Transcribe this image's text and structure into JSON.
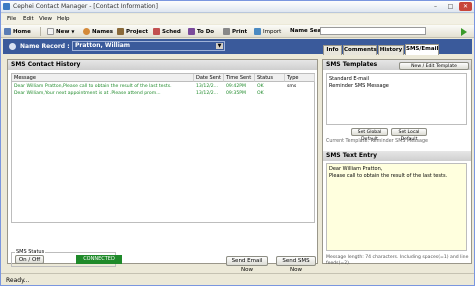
{
  "window": {
    "title": "Cephei Contact Manager - [Contact Information]"
  },
  "menu": [
    "File",
    "Edit",
    "View",
    "Help"
  ],
  "toolbar": {
    "home": "Home",
    "new": "New",
    "names": "Names",
    "project": "Project",
    "sched": "Sched",
    "todo": "To Do",
    "print": "Print",
    "import": "Import",
    "name_search_label": "Name Search :",
    "name_search_value": ""
  },
  "name_record": {
    "label": "Name Record :",
    "value": "Pratton, William"
  },
  "tabs": [
    "Info",
    "Comments",
    "History",
    "SMS/Email"
  ],
  "sms_history": {
    "title": "SMS Contact History",
    "columns": [
      "Message",
      "Date Sent",
      "Time Sent",
      "Status",
      "Type"
    ],
    "rows": [
      {
        "message": "Dear William Pratton,Please call to obtain the result of the last tests.",
        "date": "13/12/2...",
        "time": "09:42PM",
        "status": "OK",
        "type": "sms"
      },
      {
        "message": "Dear William,Your next appointment is at .Please attend prom...",
        "date": "13/12/2...",
        "time": "09:35PM",
        "status": "OK",
        "type": ""
      }
    ],
    "sms_status_label": "SMS Status",
    "onoff": "On / Off",
    "connected": "CONNECTED",
    "send_email": "Send Email Now",
    "send_sms": "Send SMS Now"
  },
  "templates": {
    "title": "SMS Templates",
    "new_edit": "New / Edit Template",
    "items": [
      "Standard E-mail",
      "Reminder SMS Message"
    ],
    "set_global": "Set Global Default",
    "set_local": "Set Local Default",
    "current": "Current Template:  Reminder SMS Message"
  },
  "sms_entry": {
    "title": "SMS Text Entry",
    "line1": "Dear William Pratton,",
    "line2": "Please call to obtain the result of the last tests.",
    "length_text": "Message length:  74  characters. Including spaces(=1) and line feeds(=2)."
  },
  "status": {
    "text": "Ready..."
  }
}
